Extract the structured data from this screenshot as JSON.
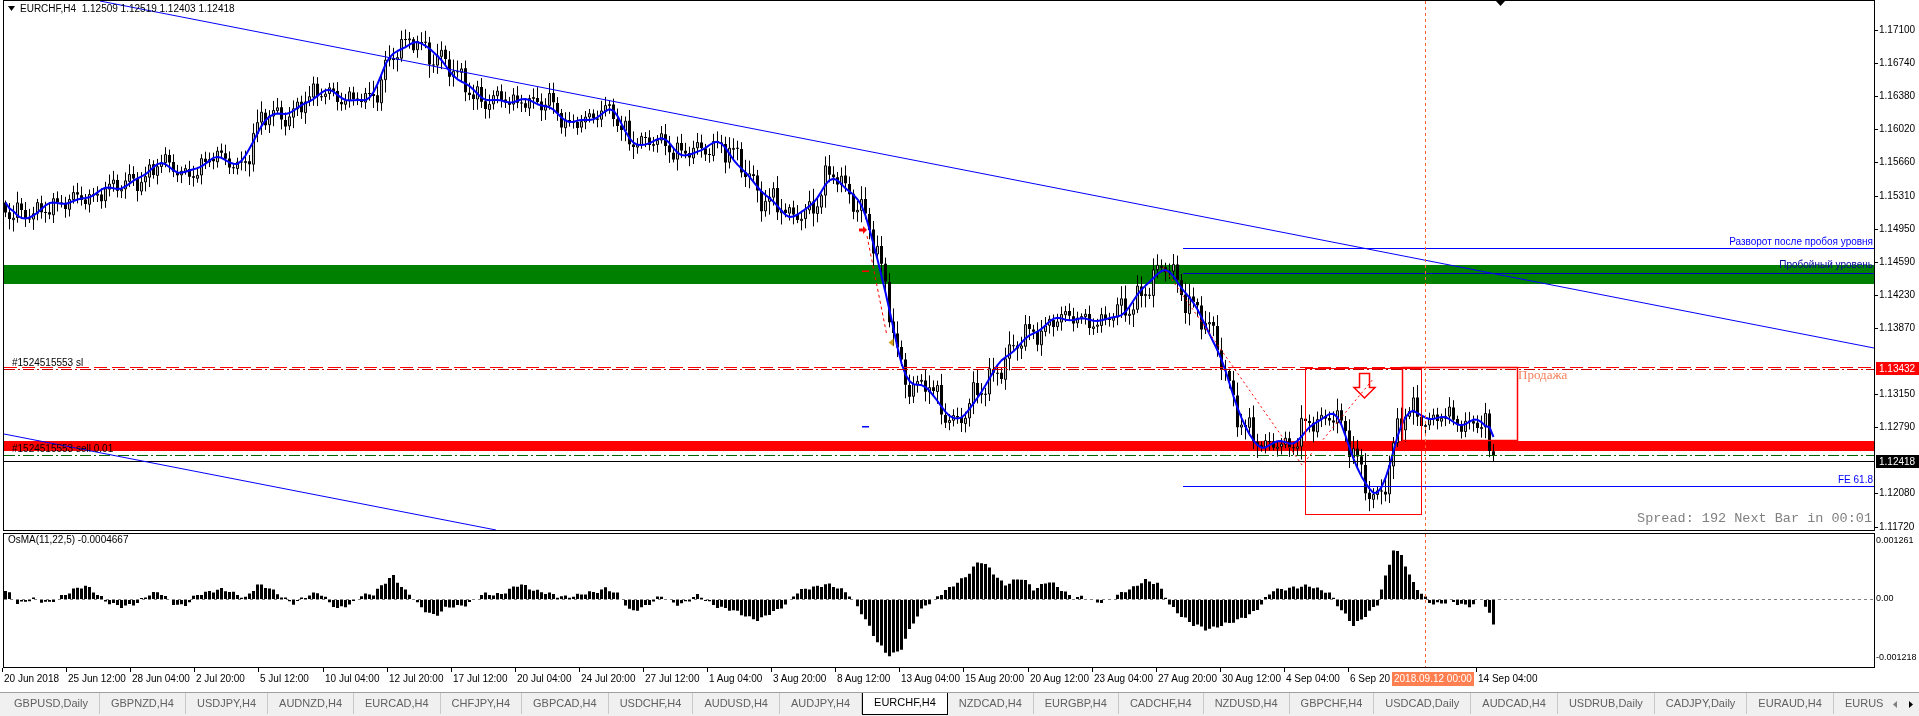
{
  "chart": {
    "title": "EURCHF,H4  1.12509 1.12519 1.12403 1.12418",
    "orders": [
      {
        "kind": "stop-loss",
        "text": "#1524515553 sl"
      },
      {
        "kind": "entry",
        "text": "#1524515553 sell 0.01"
      }
    ],
    "annotations": [
      {
        "kind": "reversal-level",
        "text": "Разворот после пробоя уровня"
      },
      {
        "kind": "breakout-level",
        "text": "Пробойный уровень"
      },
      {
        "kind": "sell-zone",
        "text": "Продажа"
      },
      {
        "kind": "fibo-level",
        "text": "FE 61.8"
      }
    ],
    "info": "Spread: 192 Next Bar in 00:01",
    "price_axis": {
      "labels": [
        "1.17100",
        "1.16740",
        "1.16380",
        "1.16020",
        "1.15660",
        "1.15310",
        "1.14950",
        "1.14590",
        "1.14230",
        "1.13870",
        "1.13150",
        "1.12790",
        "1.12080",
        "1.11720"
      ],
      "markers": [
        {
          "kind": "stop-loss",
          "text": "1.13432"
        },
        {
          "kind": "bid",
          "text": "1.12418"
        }
      ]
    }
  },
  "indicator": {
    "title": "OsMA(11,22,5) -0.0004667",
    "axis_labels": [
      "0.001261",
      "0.00",
      "-0.001218"
    ]
  },
  "time_axis": {
    "labels": [
      "20 Jun 2018",
      "25 Jun 12:00",
      "28 Jun 04:00",
      "2 Jul 20:00",
      "5 Jul 12:00",
      "10 Jul 04:00",
      "12 Jul 20:00",
      "17 Jul 12:00",
      "20 Jul 04:00",
      "24 Jul 20:00",
      "27 Jul 12:00",
      "1 Aug 04:00",
      "3 Aug 20:00",
      "8 Aug 12:00",
      "13 Aug 04:00",
      "15 Aug 20:00",
      "20 Aug 12:00",
      "23 Aug 04:00",
      "27 Aug 20:00",
      "30 Aug 12:00",
      "4 Sep 04:00",
      "6 Sep 20",
      "14 Sep 04:00"
    ],
    "cursor_label": "2018.09.12 00:00"
  },
  "tabs": [
    {
      "label": "GBPUSD,Daily",
      "selected": false
    },
    {
      "label": "GBPNZD,H4",
      "selected": false
    },
    {
      "label": "USDJPY,H4",
      "selected": false
    },
    {
      "label": "AUDNZD,H4",
      "selected": false
    },
    {
      "label": "EURCAD,H4",
      "selected": false
    },
    {
      "label": "CHFJPY,H4",
      "selected": false
    },
    {
      "label": "GBPCAD,H4",
      "selected": false
    },
    {
      "label": "USDCHF,H4",
      "selected": false
    },
    {
      "label": "AUDUSD,H4",
      "selected": false
    },
    {
      "label": "AUDJPY,H4",
      "selected": false
    },
    {
      "label": "EURCHF,H4",
      "selected": true
    },
    {
      "label": "NZDCAD,H4",
      "selected": false
    },
    {
      "label": "EURGBP,H4",
      "selected": false
    },
    {
      "label": "CADCHF,H4",
      "selected": false
    },
    {
      "label": "NZDUSD,H4",
      "selected": false
    },
    {
      "label": "GBPCHF,H4",
      "selected": false
    },
    {
      "label": "USDCAD,Daily",
      "selected": false
    },
    {
      "label": "AUDCAD,H4",
      "selected": false
    },
    {
      "label": "USDRUB,Daily",
      "selected": false
    },
    {
      "label": "CADJPY,Daily",
      "selected": false
    },
    {
      "label": "EURAUD,H4",
      "selected": false
    },
    {
      "label": "EURUS",
      "selected": false
    }
  ]
}
